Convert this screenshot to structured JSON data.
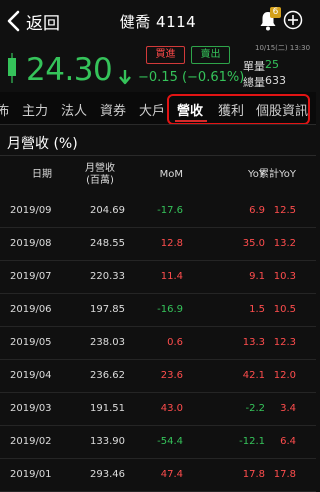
{
  "nav": {
    "back_label": "返回",
    "title": "健喬 4114",
    "notification_count": "6"
  },
  "quote": {
    "buy_label": "買進",
    "sell_label": "賣出",
    "datetime": "10/15(二) 13:30",
    "price": "24.30",
    "change": "−0.15 (−0.61%)",
    "unit_volume_label": "單量",
    "unit_volume": "25",
    "total_volume_label": "總量",
    "total_volume": "633",
    "up_color": "#ff4d4d",
    "down_color": "#35c35a"
  },
  "tabs": [
    "佈",
    "主力",
    "法人",
    "資券",
    "大戶",
    "營收",
    "獲利",
    "個股資訊"
  ],
  "active_tab": "營收",
  "section_title": "月營收 (%)",
  "table": {
    "headers": {
      "date": "日期",
      "revenue_line1": "月營收",
      "revenue_line2": "(百萬)",
      "mom": "MoM",
      "yoy": "YoY",
      "cum_yoy": "累計YoY"
    },
    "rows": [
      {
        "date": "2019/09",
        "revenue": "204.69",
        "mom": "-17.6",
        "yoy": "6.9",
        "cum": "12.5"
      },
      {
        "date": "2019/08",
        "revenue": "248.55",
        "mom": "12.8",
        "yoy": "35.0",
        "cum": "13.2"
      },
      {
        "date": "2019/07",
        "revenue": "220.33",
        "mom": "11.4",
        "yoy": "9.1",
        "cum": "10.3"
      },
      {
        "date": "2019/06",
        "revenue": "197.85",
        "mom": "-16.9",
        "yoy": "1.5",
        "cum": "10.5"
      },
      {
        "date": "2019/05",
        "revenue": "238.03",
        "mom": "0.6",
        "yoy": "13.3",
        "cum": "12.3"
      },
      {
        "date": "2019/04",
        "revenue": "236.62",
        "mom": "23.6",
        "yoy": "42.1",
        "cum": "12.0"
      },
      {
        "date": "2019/03",
        "revenue": "191.51",
        "mom": "43.0",
        "yoy": "-2.2",
        "cum": "3.4"
      },
      {
        "date": "2019/02",
        "revenue": "133.90",
        "mom": "-54.4",
        "yoy": "-12.1",
        "cum": "6.4"
      },
      {
        "date": "2019/01",
        "revenue": "293.46",
        "mom": "47.4",
        "yoy": "17.8",
        "cum": "17.8"
      }
    ]
  }
}
